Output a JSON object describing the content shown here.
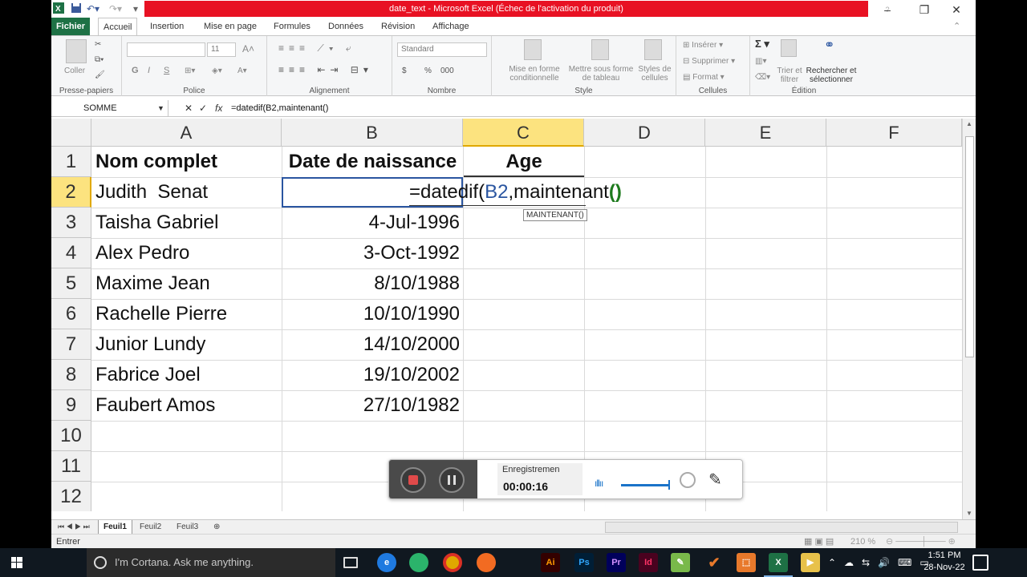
{
  "window": {
    "title": "date_text  -  Microsoft Excel (Échec de l'activation du produit)",
    "controls": {
      "minimize": "–",
      "restore": "❐",
      "close": "✕"
    }
  },
  "ribbon": {
    "tabs": [
      "Fichier",
      "Accueil",
      "Insertion",
      "Mise en page",
      "Formules",
      "Données",
      "Révision",
      "Affichage"
    ],
    "active_tab": "Accueil",
    "groups": {
      "clipboard": {
        "label": "Presse-papiers",
        "paste": "Coller"
      },
      "font": {
        "label": "Police",
        "size": "11",
        "bold": "G",
        "italic": "I",
        "underline": "S"
      },
      "alignment": {
        "label": "Alignement"
      },
      "number": {
        "label": "Nombre",
        "format": "Standard",
        "currency": "$",
        "percent": "%",
        "thousands": "000"
      },
      "style": {
        "label": "Style",
        "conditional": [
          "Mise en forme",
          "conditionnelle"
        ],
        "table": [
          "Mettre sous forme",
          "de tableau"
        ],
        "cell_styles": [
          "Styles de",
          "cellules"
        ]
      },
      "cells": {
        "label": "Cellules",
        "insert": "Insérer",
        "delete": "Supprimer",
        "format": "Format"
      },
      "editing": {
        "label": "Édition",
        "sigma": "Σ",
        "sort": [
          "Trier et",
          "filtrer"
        ],
        "find": [
          "Rechercher et",
          "sélectionner"
        ]
      }
    }
  },
  "formula_bar": {
    "name_box": "SOMME",
    "cancel": "✕",
    "enter": "✓",
    "fx": "fx",
    "formula": "=datedif(B2,maintenant()"
  },
  "grid": {
    "columns": [
      "A",
      "B",
      "C",
      "D",
      "E",
      "F"
    ],
    "selected_column": "C",
    "rows": [
      "1",
      "2",
      "3",
      "4",
      "5",
      "6",
      "7",
      "8",
      "9",
      "10",
      "11",
      "12"
    ],
    "selected_row": "2",
    "headers": {
      "A": "Nom complet",
      "B": "Date de naissance",
      "C": "Age"
    },
    "data": [
      {
        "name": "Judith  Senat",
        "date": ""
      },
      {
        "name": "Taisha Gabriel",
        "date": "4-Jul-1996"
      },
      {
        "name": "Alex Pedro",
        "date": "3-Oct-1992"
      },
      {
        "name": "Maxime Jean",
        "date": "8/10/1988"
      },
      {
        "name": "Rachelle Pierre",
        "date": "10/10/1990"
      },
      {
        "name": "Junior Lundy",
        "date": "14/10/2000"
      },
      {
        "name": "Fabrice Joel",
        "date": "19/10/2002"
      },
      {
        "name": "Faubert Amos",
        "date": "27/10/1982"
      }
    ],
    "editing": {
      "prefix": "=datedif(",
      "ref": "B2",
      "middle": ",maintenant",
      "parens": "()",
      "tooltip": "MAINTENANT()"
    }
  },
  "sheets": {
    "tabs": [
      "Feuil1",
      "Feuil2",
      "Feuil3"
    ],
    "active": "Feuil1"
  },
  "status": {
    "mode": "Entrer",
    "zoom": "210 %"
  },
  "recorder": {
    "label": "Enregistremen",
    "time": "00:00:16",
    "colors": {
      "stop": "#e04a4a",
      "accent": "#1a73c9"
    }
  },
  "taskbar": {
    "search_placeholder": "I'm Cortana. Ask me anything.",
    "time": "1:51 PM",
    "date": "28-Nov-22",
    "apps": [
      "task-view",
      "edge-legacy",
      "edge",
      "chrome",
      "firefox",
      "illustrator",
      "photoshop",
      "premiere",
      "indesign",
      "notepad",
      "xampp",
      "app-orange",
      "excel",
      "folder"
    ],
    "labels": {
      "illustrator": "Ai",
      "photoshop": "Ps",
      "premiere": "Pr",
      "indesign": "Id"
    }
  },
  "colors": {
    "title_bar": "#e81123",
    "file_tab": "#1e7145",
    "selection_header": "#fce37f",
    "taskbar": "#101820",
    "formula_ref": "#2a55a0",
    "formula_paren": "#1e7b1e"
  }
}
